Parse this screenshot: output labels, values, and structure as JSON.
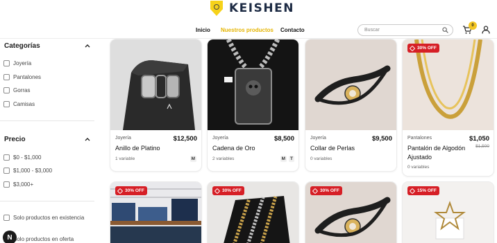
{
  "brand": {
    "name": "KEISHEN"
  },
  "nav": [
    {
      "label": "Inicio"
    },
    {
      "label": "Nuestros productos"
    },
    {
      "label": "Contacto"
    }
  ],
  "search": {
    "placeholder": "Buscar",
    "value": ""
  },
  "cart": {
    "count": "0"
  },
  "colors": {
    "accent": "#e5b400",
    "sale": "#d61f26",
    "dark": "#1b1b1b"
  },
  "icons": [
    "logo-icon",
    "search-icon",
    "cart-icon",
    "user-icon",
    "chevron-up-icon",
    "tag-icon"
  ],
  "sidebar": {
    "categories": {
      "title": "Categorías",
      "options": [
        "Joyería",
        "Pantalones",
        "Gorras",
        "Camisas"
      ]
    },
    "price": {
      "title": "Precio",
      "options": [
        "$0 - $1,000",
        "$1,000 - $3,000",
        "$3,000+"
      ]
    },
    "filters": [
      "Solo productos en existencia",
      "Solo productos en oferta"
    ],
    "floating_badge": "N"
  },
  "products": [
    {
      "category": "Joyería",
      "price": "$12,500",
      "old_price": "",
      "name": "Anillo de Platino",
      "variants": "1 variable",
      "sizes": [
        "M"
      ],
      "badge": ""
    },
    {
      "category": "Joyería",
      "price": "$8,500",
      "old_price": "",
      "name": "Cadena de Oro",
      "variants": "2 variables",
      "sizes": [
        "M",
        "T"
      ],
      "badge": ""
    },
    {
      "category": "Joyería",
      "price": "$9,500",
      "old_price": "",
      "name": "Collar de Perlas",
      "variants": "0 variables",
      "sizes": [],
      "badge": ""
    },
    {
      "category": "Pantalones",
      "price": "$1,050",
      "old_price": "$1,500",
      "name": "Pantalón de Algodón Ajustado",
      "variants": "0 variables",
      "sizes": [],
      "badge": "30% OFF"
    },
    {
      "badge": "30% OFF"
    },
    {
      "badge": "30% OFF"
    },
    {
      "badge": "30% OFF"
    },
    {
      "badge": "15% OFF"
    }
  ]
}
